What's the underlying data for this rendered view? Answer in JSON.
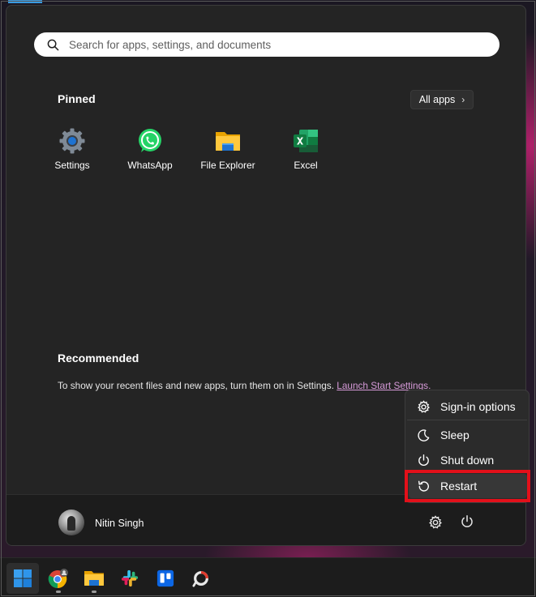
{
  "search": {
    "placeholder": "Search for apps, settings, and documents"
  },
  "pinned": {
    "title": "Pinned",
    "all_apps_label": "All apps",
    "apps": [
      {
        "label": "Settings",
        "icon": "settings-gear-icon"
      },
      {
        "label": "WhatsApp",
        "icon": "whatsapp-icon"
      },
      {
        "label": "File Explorer",
        "icon": "folder-icon"
      },
      {
        "label": "Excel",
        "icon": "excel-icon"
      }
    ]
  },
  "recommended": {
    "title": "Recommended",
    "text": "To show your recent files and new apps, turn them on in Settings.",
    "link": "Launch Start Settings."
  },
  "power_menu": {
    "items": [
      {
        "label": "Sign-in options",
        "icon": "gear-icon"
      },
      {
        "label": "Sleep",
        "icon": "moon-icon"
      },
      {
        "label": "Shut down",
        "icon": "power-icon"
      },
      {
        "label": "Restart",
        "icon": "restart-icon"
      }
    ],
    "highlight_color": "#e3101a"
  },
  "user": {
    "name": "Nitin Singh"
  },
  "taskbar": {
    "items": [
      {
        "name": "start",
        "icon": "windows-logo-icon"
      },
      {
        "name": "chrome",
        "icon": "chrome-icon"
      },
      {
        "name": "file-explorer",
        "icon": "folder-icon"
      },
      {
        "name": "slack",
        "icon": "slack-icon"
      },
      {
        "name": "trello",
        "icon": "trello-icon"
      },
      {
        "name": "app",
        "icon": "ring-app-icon"
      }
    ]
  },
  "colors": {
    "menu_bg": "#242424",
    "user_bar_bg": "#1c1c1c",
    "link": "#d69ad8",
    "accent": "#0078d4"
  }
}
